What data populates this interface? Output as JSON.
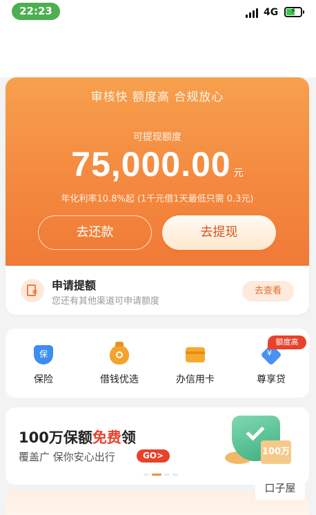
{
  "status_bar": {
    "time": "22:23",
    "network": "4G"
  },
  "hero": {
    "slogan": "审核快 额度高 合规放心",
    "available_label": "可提现额度",
    "amount": "75,000.00",
    "unit": "元",
    "rate_text": "年化利率10.8%起 (1千元借1天最低只需 0.3元)",
    "repay_label": "去还款",
    "withdraw_label": "去提现"
  },
  "quota": {
    "title": "申请提额",
    "subtitle": "您还有其他渠道可申请额度",
    "button_label": "去查看"
  },
  "services": {
    "items": [
      {
        "label": "保险",
        "icon": "shield-icon",
        "icon_text": "保"
      },
      {
        "label": "借钱优选",
        "icon": "money-bag-icon"
      },
      {
        "label": "办信用卡",
        "icon": "credit-card-icon"
      },
      {
        "label": "尊享贷",
        "icon": "diamond-icon",
        "icon_text": "¥"
      }
    ],
    "badge": "额度高"
  },
  "banner": {
    "title_prefix": "100万保额",
    "title_highlight": "免费",
    "title_suffix": "领",
    "subtitle": "覆盖广 保你安心出行",
    "go_label": "GO>",
    "bill_text": "100万"
  },
  "watermark": "口子屋",
  "colors": {
    "accent": "#f4893f",
    "badge_red": "#e9412b",
    "button_text": "#d8541e"
  }
}
